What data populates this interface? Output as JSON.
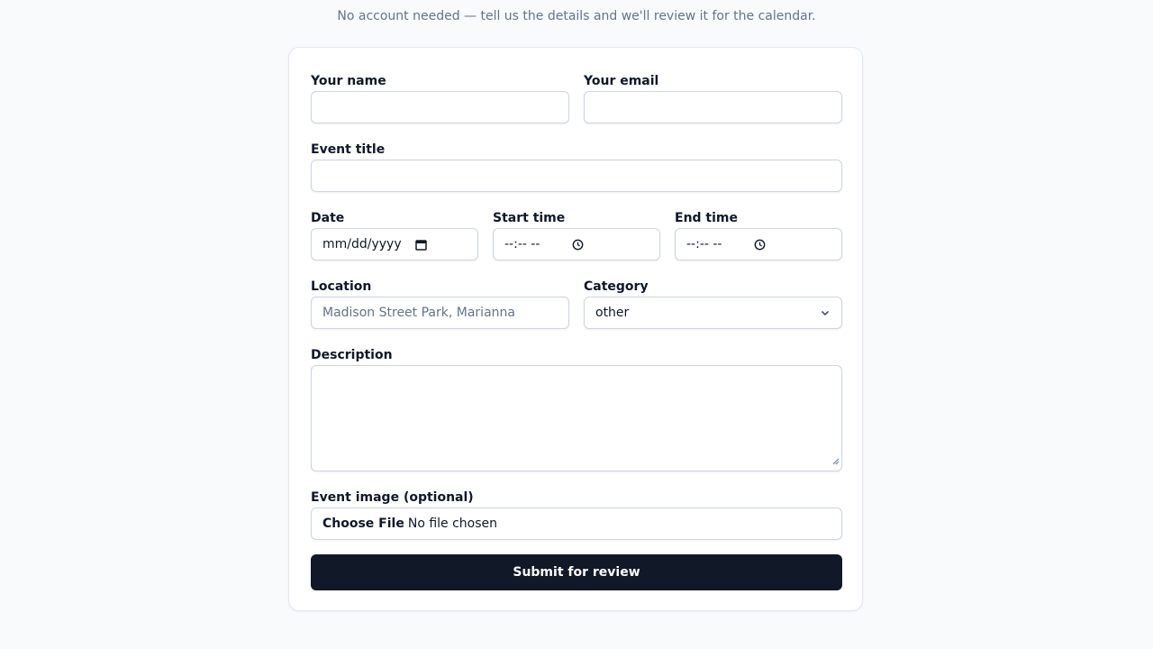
{
  "header": {
    "subtitle": "No account needed — tell us the details and we'll review it for the calendar."
  },
  "form": {
    "name": {
      "label": "Your name",
      "value": ""
    },
    "email": {
      "label": "Your email",
      "value": ""
    },
    "title": {
      "label": "Event title",
      "value": ""
    },
    "date": {
      "label": "Date",
      "placeholder": "mm/dd/yyyy",
      "icon": "calendar-icon"
    },
    "start_time": {
      "label": "Start time",
      "placeholder": "--:-- --",
      "icon": "clock-icon"
    },
    "end_time": {
      "label": "End time",
      "placeholder": "--:-- --",
      "icon": "clock-icon"
    },
    "location": {
      "label": "Location",
      "placeholder": "Madison Street Park, Marianna"
    },
    "category": {
      "label": "Category",
      "value": "other",
      "icon": "chevron-down-icon"
    },
    "description": {
      "label": "Description",
      "value": ""
    },
    "image": {
      "label": "Event image (optional)",
      "button": "Choose File",
      "status": "No file chosen"
    },
    "submit_label": "Submit for review"
  },
  "colors": {
    "background": "#f8fafc",
    "card": "#ffffff",
    "border": "#cbd5e1",
    "primary_button": "#111827",
    "muted_text": "#64748b"
  }
}
